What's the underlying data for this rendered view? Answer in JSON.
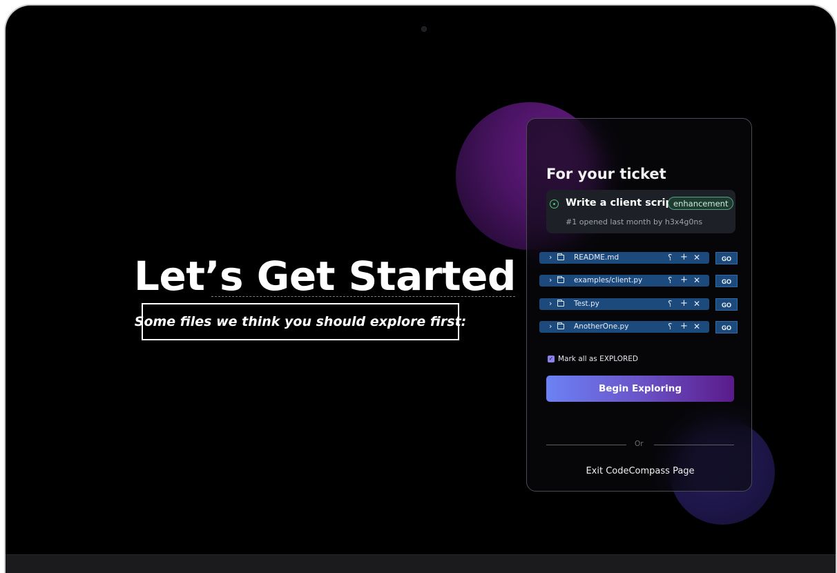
{
  "hero": {
    "title": "Let’s Get Started",
    "subtitle": "Some files we think you should explore first:"
  },
  "panel": {
    "title": "For your ticket",
    "ticket": {
      "icon": "issue-open-icon",
      "title": "Write a client script",
      "label": "enhancement",
      "meta": "#1 opened last month by h3x4g0ns"
    },
    "files": [
      {
        "name": "README.md",
        "go_label": "GO"
      },
      {
        "name": "examples/client.py",
        "go_label": "GO"
      },
      {
        "name": "Test.py",
        "go_label": "GO"
      },
      {
        "name": "AnotherOne.py",
        "go_label": "GO"
      }
    ],
    "file_actions": {
      "chevron": "›",
      "undo": "⸮",
      "add": "+",
      "remove": "✕"
    },
    "mark_all_label": "Mark all as EXPLORED",
    "mark_all_checked": true,
    "begin_label": "Begin Exploring",
    "or_label": "Or",
    "exit_label": "Exit CodeCompass Page"
  },
  "colors": {
    "background": "#000000",
    "file_pill": "#1d4a7d",
    "label_border": "#53a581",
    "open_issue": "#57c07a",
    "button_gradient_start": "#6c82f4",
    "button_gradient_end": "#5a1a8a"
  }
}
